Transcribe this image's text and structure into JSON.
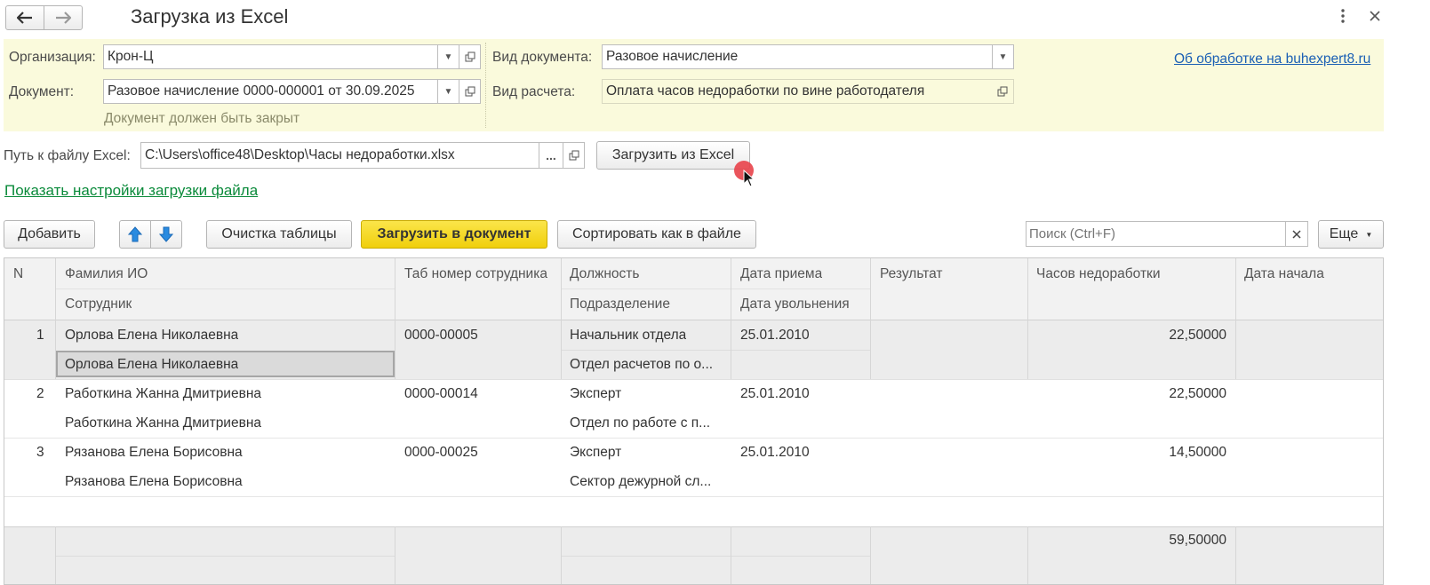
{
  "window": {
    "title": "Загрузка из Excel",
    "back_icon": "arrow-left-icon",
    "forward_icon": "arrow-right-icon",
    "menu_icon": "vertical-dots-icon",
    "close_icon": "close-icon"
  },
  "header": {
    "org_label": "Организация:",
    "org_value": "Крон-Ц",
    "doc_label": "Документ:",
    "doc_value": "Разовое начисление 0000-000001 от 30.09.2025",
    "doc_note": "Документ должен быть закрыт",
    "doc_type_label": "Вид документа:",
    "doc_type_value": "Разовое начисление",
    "calc_type_label": "Вид расчета:",
    "calc_type_value": "Оплата часов недоработки по вине работодателя",
    "about_link": "Об обработке на buhexpert8.ru"
  },
  "file": {
    "path_label": "Путь к файлу Excel:",
    "path_value": "C:\\Users\\office48\\Desktop\\Часы недоработки.xlsx",
    "browse_label": "...",
    "load_button": "Загрузить из Excel",
    "settings_link": "Показать настройки загрузки файла"
  },
  "toolbar": {
    "add": "Добавить",
    "clear": "Очистка таблицы",
    "load_doc": "Загрузить в документ",
    "sort": "Сортировать как в файле",
    "search_placeholder": "Поиск (Ctrl+F)",
    "more": "Еще"
  },
  "table": {
    "headers": {
      "n": "N",
      "fio": "Фамилия ИО",
      "employee": "Сотрудник",
      "tab": "Таб номер сотрудника",
      "position": "Должность",
      "department": "Подразделение",
      "hire": "Дата приема",
      "fire": "Дата увольнения",
      "result": "Результат",
      "hours": "Часов недоработки",
      "start": "Дата начала"
    },
    "rows": [
      {
        "n": "1",
        "fio": "Орлова Елена Николаевна",
        "employee": "Орлова Елена Николаевна",
        "tab": "0000-00005",
        "position": "Начальник отдела",
        "department": "Отдел расчетов по о...",
        "hire": "25.01.2010",
        "hours": "22,50000"
      },
      {
        "n": "2",
        "fio": "Работкина Жанна Дмитриевна",
        "employee": "Работкина Жанна Дмитриевна",
        "tab": "0000-00014",
        "position": "Эксперт",
        "department": "Отдел по работе с п...",
        "hire": "25.01.2010",
        "hours": "22,50000"
      },
      {
        "n": "3",
        "fio": "Рязанова Елена Борисовна",
        "employee": "Рязанова Елена Борисовна",
        "tab": "0000-00025",
        "position": "Эксперт",
        "department": "Сектор дежурной сл...",
        "hire": "25.01.2010",
        "hours": "14,50000"
      }
    ],
    "total_hours": "59,50000"
  },
  "colors": {
    "header_bg": "#fafadc",
    "load_doc_bg": "#f5d816",
    "selected_row": "#ececec",
    "cursor_dot": "#e8434a"
  }
}
